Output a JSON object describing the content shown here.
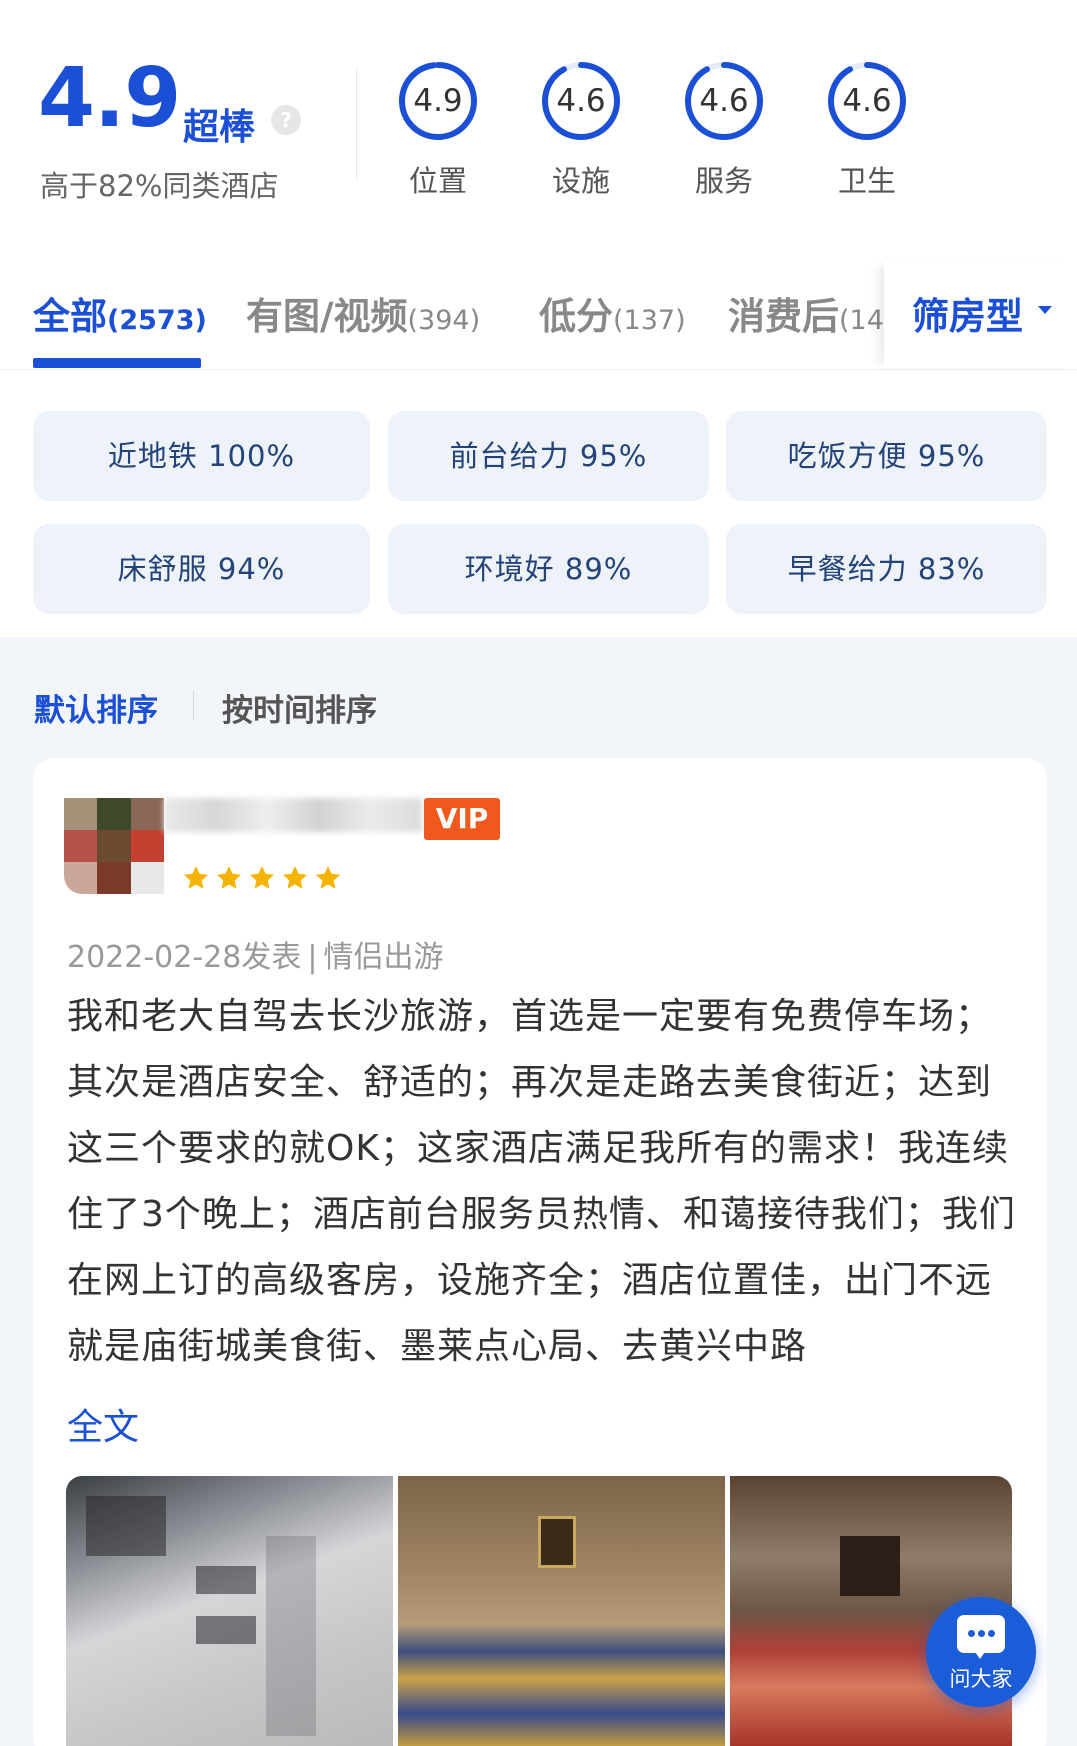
{
  "overall": {
    "score": "4.9",
    "grade": "超棒",
    "help_icon": "?",
    "compare_text": "高于82%同类酒店"
  },
  "sub_scores": [
    {
      "value": "4.9",
      "label": "位置",
      "fraction": 0.98
    },
    {
      "value": "4.6",
      "label": "设施",
      "fraction": 0.92
    },
    {
      "value": "4.6",
      "label": "服务",
      "fraction": 0.92
    },
    {
      "value": "4.6",
      "label": "卫生",
      "fraction": 0.92
    }
  ],
  "tabs": [
    {
      "label": "全部",
      "count": "(2573)",
      "active": true
    },
    {
      "label": "有图/视频",
      "count": "(394)",
      "active": false
    },
    {
      "label": "低分",
      "count": "(137)",
      "active": false
    },
    {
      "label": "消费后",
      "count": "(14",
      "active": false
    }
  ],
  "room_filter": {
    "label": "筛房型",
    "icon": "caret-down-icon"
  },
  "tags": [
    {
      "text": "近地铁 100%"
    },
    {
      "text": "前台给力 95%"
    },
    {
      "text": "吃饭方便 95%"
    },
    {
      "text": "床舒服 94%"
    },
    {
      "text": "环境好 89%"
    },
    {
      "text": "早餐给力 83%"
    }
  ],
  "sort": {
    "default": "默认排序",
    "by_time": "按时间排序"
  },
  "review": {
    "vip": "VIP",
    "stars": 5,
    "date": "2022-02-28发表",
    "separator": "|",
    "trip_type": "情侣出游",
    "text": "我和老大自驾去长沙旅游，首选是一定要有免费停车场；其次是酒店安全、舒适的；再次是走路去美食街近；达到这三个要求的就OK；这家酒店满足我所有的需求！我连续住了3个晚上；酒店前台服务员热情、和蔼接待我们；我们在网上订的高级客房，设施齐全；酒店位置佳，出门不远就是庙街城美食街、墨莱点心局、去黄兴中路",
    "full_text_link": "全文"
  },
  "ask_button": {
    "label": "问大家",
    "icon": "chat-bubble-icon"
  },
  "colors": {
    "accent": "#1a4fd6",
    "vip": "#f0581e",
    "star": "#f5b400",
    "chip_bg": "#eef3fa",
    "band_bg": "#f2f5fa"
  }
}
